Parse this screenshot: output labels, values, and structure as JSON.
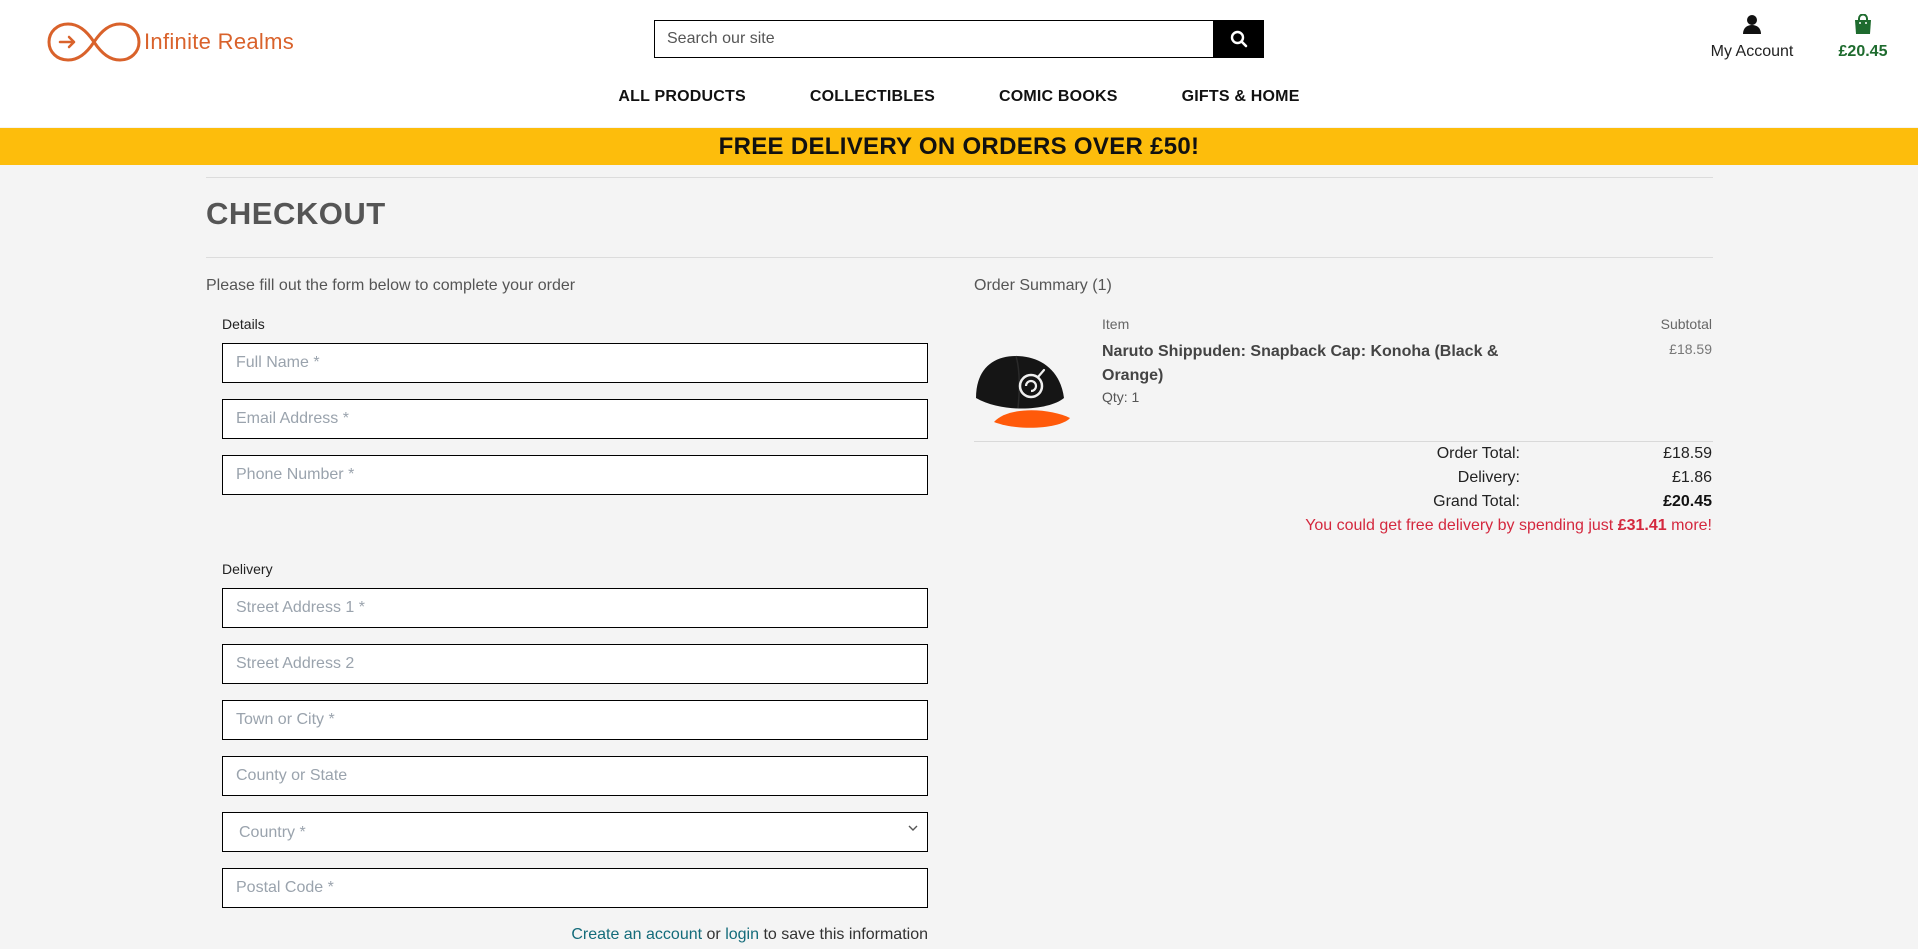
{
  "brand": {
    "name": "Infinite Realms",
    "logo_color": "#d9622b"
  },
  "search": {
    "placeholder": "Search our site",
    "icon": "search-icon"
  },
  "header": {
    "account_label": "My Account",
    "account_icon": "user-icon",
    "bag_icon": "shopping-bag-icon",
    "bag_total": "£20.45"
  },
  "nav": {
    "items": [
      "ALL PRODUCTS",
      "COLLECTIBLES",
      "COMIC BOOKS",
      "GIFTS & HOME"
    ]
  },
  "banner": {
    "text": "FREE DELIVERY ON ORDERS OVER £50!",
    "color": "#fdbd0c"
  },
  "page": {
    "title": "CHECKOUT",
    "intro": "Please fill out the form below to complete your order"
  },
  "form": {
    "details_label": "Details",
    "full_name_placeholder": "Full Name *",
    "email_placeholder": "Email Address *",
    "phone_placeholder": "Phone Number *",
    "delivery_label": "Delivery",
    "street1_placeholder": "Street Address 1 *",
    "street2_placeholder": "Street Address 2",
    "town_placeholder": "Town or City *",
    "county_placeholder": "County or State",
    "country_selected": "Country *",
    "postcode_placeholder": "Postal Code *",
    "save_info": {
      "create_link": "Create an account",
      "or": "or",
      "login_link": "login",
      "suffix": "to save this information"
    }
  },
  "summary": {
    "title": "Order Summary (1)",
    "col_item": "Item",
    "col_subtotal": "Subtotal",
    "product": {
      "name": "Naruto Shippuden: Snapback Cap: Konoha (Black & Orange)",
      "qty": "Qty: 1",
      "subtotal": "£18.59"
    },
    "order_total_label": "Order Total:",
    "order_total": "£18.59",
    "delivery_label": "Delivery:",
    "delivery": "£1.86",
    "grand_total_label": "Grand Total:",
    "grand_total": "£20.45",
    "free_delivery": {
      "prefix": "You could get free delivery by spending just",
      "amount": "£31.41",
      "suffix": "more!",
      "color": "#d4283e"
    }
  }
}
